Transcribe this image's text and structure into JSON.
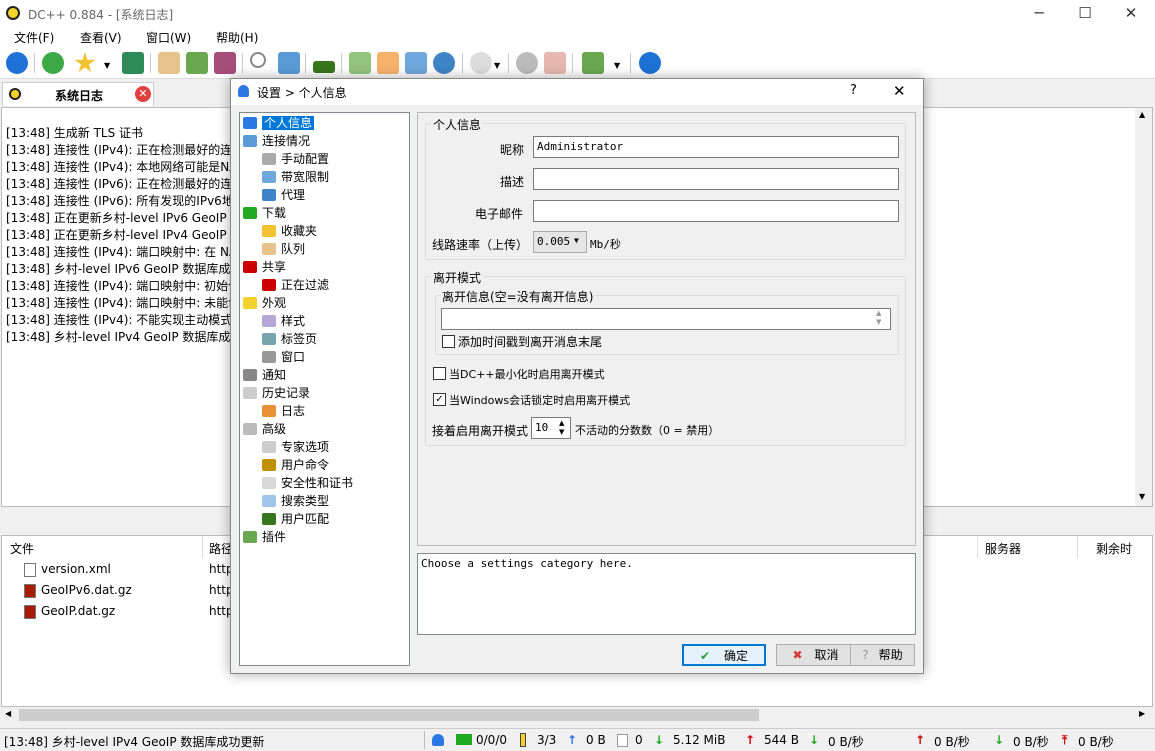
{
  "window": {
    "title": "DC++ 0.884 - [系统日志]",
    "controls": [
      "─",
      "☐",
      "✕"
    ]
  },
  "menu": [
    "文件(F)",
    "查看(V)",
    "窗口(W)",
    "帮助(H)"
  ],
  "tab": {
    "label": "系统日志"
  },
  "log": [
    "[13:48] 生成新 TLS 证书",
    "[13:48] 连接性 (IPv4): 正在检测最好的连接",
    "[13:48] 连接性 (IPv4): 本地网络可能是NA",
    "[13:48] 连接性 (IPv6): 正在检测最好的连接",
    "[13:48] 连接性 (IPv6): 所有发现的IPv6地址",
    "[13:48] 正在更新乡村-level IPv6 GeoIP 数",
    "[13:48] 正在更新乡村-level IPv4 GeoIP 数",
    "[13:48] 连接性 (IPv4): 端口映射中: 在 NA",
    "[13:48] 乡村-level IPv6 GeoIP 数据库成功",
    "[13:48] 连接性 (IPv4): 端口映射中: 初始化",
    "[13:48] 连接性 (IPv4): 端口映射中: 未能创",
    "[13:48] 连接性 (IPv4): 不能实现主动模式:",
    "[13:48] 乡村-level IPv4 GeoIP 数据库成功"
  ],
  "transfers": {
    "headers": [
      "文件",
      "路径",
      "服务器",
      "剩余时"
    ],
    "rows": [
      {
        "file": "version.xml",
        "path": "http"
      },
      {
        "file": "GeoIPv6.dat.gz",
        "path": "http"
      },
      {
        "file": "GeoIP.dat.gz",
        "path": "http"
      }
    ]
  },
  "status": {
    "message": "[13:48] 乡村-level IPv4 GeoIP 数据库成功更新",
    "hubs": "0/0/0",
    "slots": "3/3",
    "up_total": "0 B",
    "queue": "0",
    "down_total": "5.12 MiB",
    "up_bytes": "544 B",
    "down_rate": "0 B/秒",
    "up_rate": "0 B/秒",
    "down_rate2": "0 B/秒",
    "up_rate2": "0 B/秒"
  },
  "dialog": {
    "title": "设置 > 个人信息",
    "help_char": "?",
    "close_char": "✕",
    "tree": [
      {
        "label": "个人信息",
        "level": 0,
        "selected": true
      },
      {
        "label": "连接情况",
        "level": 0
      },
      {
        "label": "手动配置",
        "level": 1
      },
      {
        "label": "带宽限制",
        "level": 1
      },
      {
        "label": "代理",
        "level": 1
      },
      {
        "label": "下载",
        "level": 0
      },
      {
        "label": "收藏夹",
        "level": 1
      },
      {
        "label": "队列",
        "level": 1
      },
      {
        "label": "共享",
        "level": 0
      },
      {
        "label": "正在过滤",
        "level": 1
      },
      {
        "label": "外观",
        "level": 0
      },
      {
        "label": "样式",
        "level": 1
      },
      {
        "label": "标签页",
        "level": 1
      },
      {
        "label": "窗口",
        "level": 1
      },
      {
        "label": "通知",
        "level": 0
      },
      {
        "label": "历史记录",
        "level": 0
      },
      {
        "label": "日志",
        "level": 1
      },
      {
        "label": "高级",
        "level": 0
      },
      {
        "label": "专家选项",
        "level": 1
      },
      {
        "label": "用户命令",
        "level": 1
      },
      {
        "label": "安全性和证书",
        "level": 1
      },
      {
        "label": "搜索类型",
        "level": 1
      },
      {
        "label": "用户匹配",
        "level": 1
      },
      {
        "label": "插件",
        "level": 0
      }
    ],
    "personal": {
      "group": "个人信息",
      "nick_label": "昵称",
      "nick_value": "Administrator",
      "desc_label": "描述",
      "desc_value": "",
      "email_label": "电子邮件",
      "email_value": "",
      "speed_label": "线路速率（上传）",
      "speed_value": "0.005",
      "speed_unit": "Mb/秒"
    },
    "away": {
      "group": "离开模式",
      "msg_group": "离开信息(空=没有离开信息)",
      "msg_value": "",
      "timestamp_label": "添加时间戳到离开消息末尾",
      "timestamp_checked": false,
      "minimize_label": "当DC++最小化时启用离开模式",
      "minimize_checked": false,
      "lock_label": "当Windows会话锁定时启用离开模式",
      "lock_checked": true,
      "idle_prefix": "接着启用离开模式",
      "idle_value": "10",
      "idle_suffix": "不活动的分数数（0 = 禁用）"
    },
    "help_text": "Choose a settings category here.",
    "buttons": {
      "ok": "确定",
      "cancel": "取消",
      "help": "帮助"
    }
  }
}
